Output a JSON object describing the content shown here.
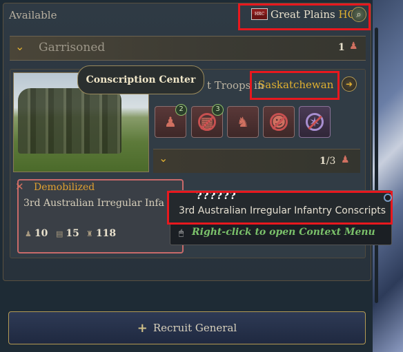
{
  "header": {
    "available_label": "Available",
    "flag_text": "HRC",
    "location_name": "Great Plains",
    "location_suffix": "HQ",
    "search_icon": "search-icon"
  },
  "garrison": {
    "title": "Garrisoned",
    "count": "1"
  },
  "recruit_row": {
    "tooltip_title": "Conscription Center",
    "text_prefix": "t Troops in",
    "province": "Saskatchewan"
  },
  "slots": [
    {
      "icon": "infantry-icon",
      "glyph": "♟",
      "badge": "2",
      "banned": false,
      "style": "red"
    },
    {
      "icon": "barracks-icon",
      "glyph": "▦",
      "badge": "3",
      "banned": true,
      "style": "red"
    },
    {
      "icon": "cavalry-icon",
      "glyph": "♞",
      "badge": "",
      "banned": false,
      "style": "red"
    },
    {
      "icon": "officer-icon",
      "glyph": "☻",
      "badge": "",
      "banned": true,
      "style": "red"
    },
    {
      "icon": "special-forces-icon",
      "glyph": "✶",
      "badge": "",
      "banned": true,
      "style": "violet"
    }
  ],
  "sub_group": {
    "count_current": "1",
    "count_total": "/3"
  },
  "unit": {
    "status": "Demobilized",
    "name_truncated": "3rd Australian Irregular Infa ..",
    "stat_1": "10",
    "stat_2": "15",
    "stat_3": "118"
  },
  "hover_tooltip": {
    "title": "??????",
    "full_name": "3rd Australian Irregular Infantry Conscripts",
    "hint": "Right-click to open Context Menu"
  },
  "recruit_button": {
    "label": "Recruit General"
  },
  "colors": {
    "highlight_box": "#e8181e",
    "gold_accent": "#e0b030",
    "hint_green": "#7ac06a"
  }
}
